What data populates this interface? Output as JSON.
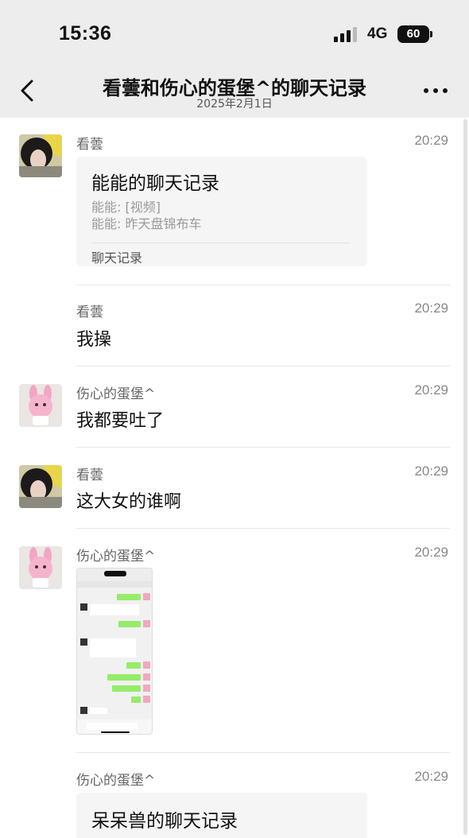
{
  "status_bar": {
    "time": "15:36",
    "network": "4G",
    "battery": "60"
  },
  "nav": {
    "title": "看蕓和伤心的蛋堡^的聊天记录",
    "subtitle": "2025年2月1日"
  },
  "messages": [
    {
      "sender": "看蕓",
      "time": "20:29",
      "card": {
        "title": "能能的聊天记录",
        "lines": [
          "能能: [视频]",
          "能能: 昨天盘锦布车"
        ],
        "footer": "聊天记录"
      }
    },
    {
      "sender": "看蕓",
      "time": "20:29",
      "text": "我操"
    },
    {
      "sender": "伤心的蛋堡^",
      "time": "20:29",
      "text": "我都要吐了"
    },
    {
      "sender": "看蕓",
      "time": "20:29",
      "text": "这大女的谁啊"
    },
    {
      "sender": "伤心的蛋堡^",
      "time": "20:29",
      "image": "chat-screenshot"
    },
    {
      "sender": "伤心的蛋堡^",
      "time": "20:29",
      "card": {
        "title": "呆呆兽的聊天记录"
      }
    }
  ],
  "colors": {
    "bar_bg": "#ededed",
    "card_bg": "#f5f5f5",
    "wechat_green": "#95ec69"
  }
}
